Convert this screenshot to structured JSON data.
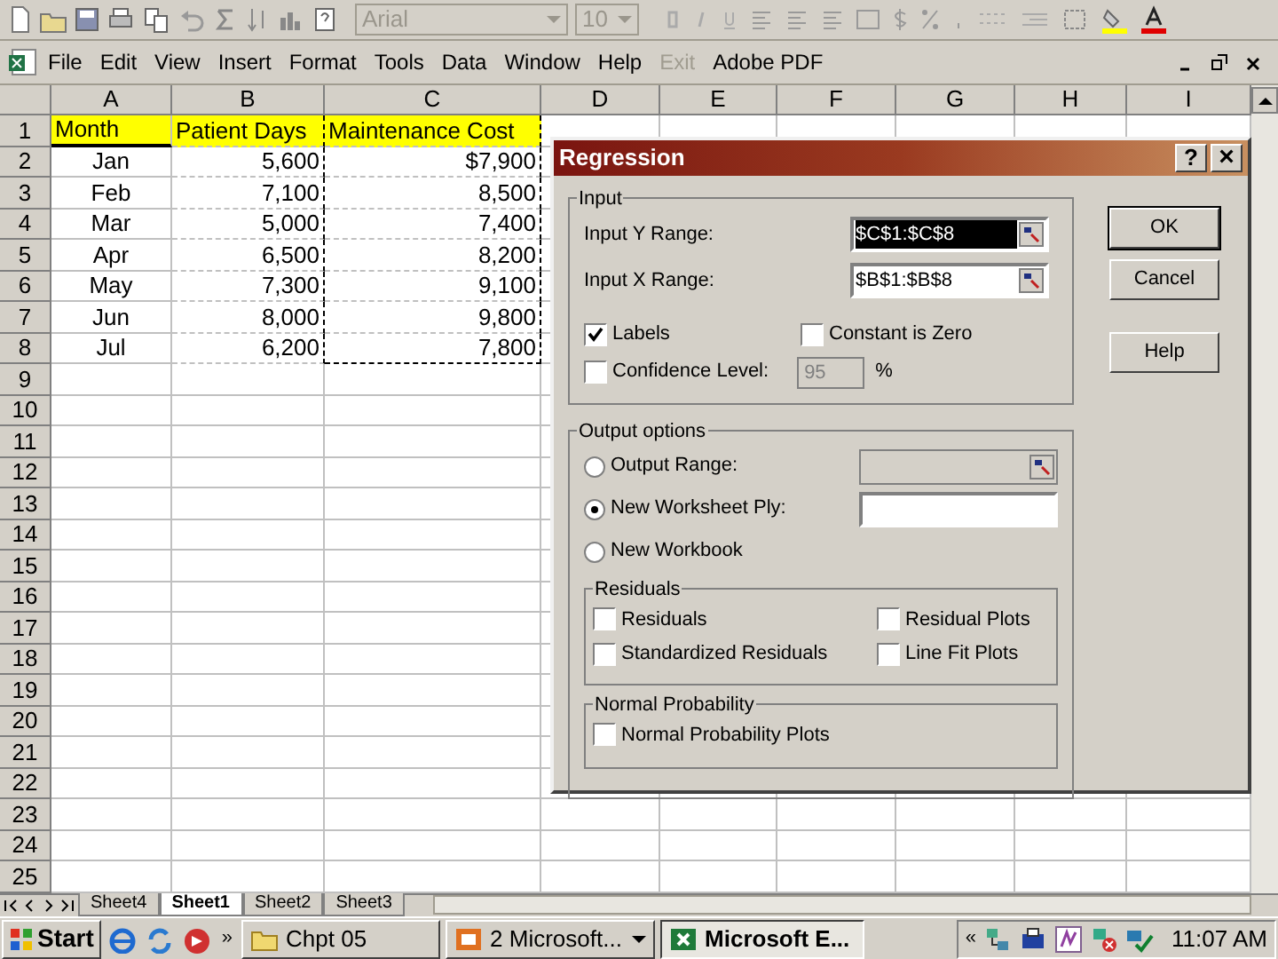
{
  "toolbar": {
    "font": "Arial",
    "size": "10"
  },
  "menu_bar": {
    "items": [
      {
        "label": "File",
        "disabled": false
      },
      {
        "label": "Edit",
        "disabled": false
      },
      {
        "label": "View",
        "disabled": false
      },
      {
        "label": "Insert",
        "disabled": false
      },
      {
        "label": "Format",
        "disabled": false
      },
      {
        "label": "Tools",
        "disabled": false
      },
      {
        "label": "Data",
        "disabled": false
      },
      {
        "label": "Window",
        "disabled": false
      },
      {
        "label": "Help",
        "disabled": false
      },
      {
        "label": "Exit",
        "disabled": true
      },
      {
        "label": "Adobe PDF",
        "disabled": false
      }
    ]
  },
  "sheet": {
    "columns": [
      "A",
      "B",
      "C",
      "D",
      "E",
      "F",
      "G",
      "H",
      "I"
    ],
    "row_numbers": [
      "1",
      "2",
      "3",
      "4",
      "5",
      "6",
      "7",
      "8",
      "9",
      "10",
      "11",
      "12",
      "13",
      "14",
      "15",
      "16",
      "17",
      "18",
      "19",
      "20",
      "21",
      "22",
      "23",
      "24",
      "25"
    ],
    "rows": [
      [
        "Month",
        "Patient Days",
        "Maintenance Cost"
      ],
      [
        "Jan",
        "5,600",
        "$7,900"
      ],
      [
        "Feb",
        "7,100",
        "8,500"
      ],
      [
        "Mar",
        "5,000",
        "7,400"
      ],
      [
        "Apr",
        "6,500",
        "8,200"
      ],
      [
        "May",
        "7,300",
        "9,100"
      ],
      [
        "Jun",
        "8,000",
        "9,800"
      ],
      [
        "Jul",
        "6,200",
        "7,800"
      ]
    ]
  },
  "dialog": {
    "title": "Regression",
    "help": "?",
    "close": "×",
    "input": {
      "legend": "Input",
      "y_label": "Input Y Range:",
      "y_value": "$C$1:$C$8",
      "x_label": "Input X Range:",
      "x_value": "$B$1:$B$8",
      "options": [
        {
          "label": "Labels",
          "checked": true
        },
        {
          "label": "Constant is Zero",
          "checked": false
        },
        {
          "label": "Confidence Level:",
          "checked": false
        }
      ],
      "confidence": "95",
      "percent": "%"
    },
    "output": {
      "legend": "Output options",
      "choices": [
        {
          "label": "Output Range:",
          "selected": false
        },
        {
          "label": "New Worksheet Ply:",
          "selected": true
        },
        {
          "label": "New Workbook",
          "selected": false
        }
      ]
    },
    "residuals": {
      "legend": "Residuals",
      "options": [
        {
          "label": "Residuals",
          "checked": false
        },
        {
          "label": "Residual Plots",
          "checked": false
        },
        {
          "label": "Standardized Residuals",
          "checked": false
        },
        {
          "label": "Line Fit Plots",
          "checked": false
        }
      ]
    },
    "normal": {
      "legend": "Normal Probability",
      "options": [
        {
          "label": "Normal Probability Plots",
          "checked": false
        }
      ]
    },
    "buttons": [
      "OK",
      "Cancel",
      "Help"
    ]
  },
  "sheet_tabs": [
    {
      "label": "Sheet4",
      "selected": false
    },
    {
      "label": "Sheet1",
      "selected": true
    },
    {
      "label": "Sheet2",
      "selected": false
    },
    {
      "label": "Sheet3",
      "selected": false
    }
  ],
  "taskbar": {
    "start": "Start",
    "chevron": "»",
    "buttons": [
      {
        "label": "Chpt  05",
        "selected": false,
        "kind": "folder"
      },
      {
        "label": "2 Microsoft...",
        "selected": false,
        "kind": "group"
      },
      {
        "label": "Microsoft E...",
        "selected": true,
        "kind": "excel"
      }
    ],
    "tray_chevron": "«",
    "clock": "11:07 AM"
  }
}
